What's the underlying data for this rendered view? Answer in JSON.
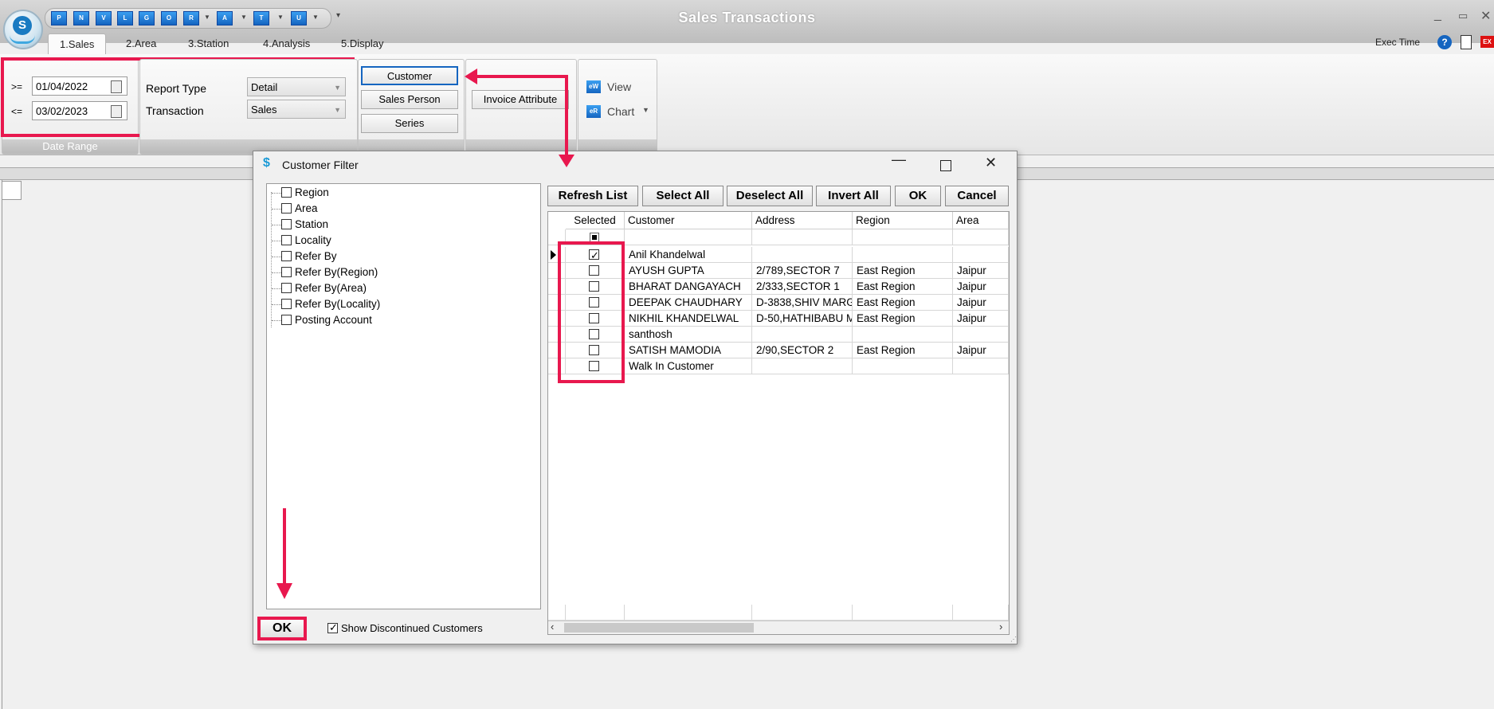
{
  "app": {
    "title": "Sales Transactions",
    "exec_time_label": "Exec Time",
    "logo_letter": "S"
  },
  "quick_access": [
    {
      "label": "P",
      "icon": "p-icon"
    },
    {
      "label": "N",
      "icon": "n-icon"
    },
    {
      "label": "V",
      "icon": "v-icon"
    },
    {
      "label": "L",
      "icon": "l-icon"
    },
    {
      "label": "G",
      "icon": "g-icon"
    },
    {
      "label": "O",
      "icon": "o-icon"
    },
    {
      "label": "R",
      "icon": "r-icon"
    },
    {
      "label": "A",
      "icon": "a-icon"
    },
    {
      "label": "T",
      "icon": "t-icon"
    },
    {
      "label": "U",
      "icon": "u-icon"
    }
  ],
  "tabs": [
    "1.Sales",
    "2.Area",
    "3.Station",
    "4.Analysis",
    "5.Display"
  ],
  "ribbon": {
    "date_range": {
      "from_op": ">=",
      "from": "01/04/2022",
      "to_op": "<=",
      "to": "03/02/2023",
      "group_label": "Date Range"
    },
    "report_type_label": "Report Type",
    "report_type_value": "Detail",
    "transaction_label": "Transaction",
    "transaction_value": "Sales",
    "filter_buttons": [
      "Customer",
      "Sales Person",
      "Series"
    ],
    "invoice_attribute": "Invoice Attribute",
    "view_label": "View",
    "chart_label": "Chart"
  },
  "dialog": {
    "title": "Customer Filter",
    "tree_items": [
      "Region",
      "Area",
      "Station",
      "Locality",
      "Refer By",
      "Refer By(Region)",
      "Refer By(Area)",
      "Refer By(Locality)",
      "Posting Account"
    ],
    "buttons": [
      "Refresh List",
      "Select All",
      "Deselect All",
      "Invert All",
      "OK",
      "Cancel"
    ],
    "ok_label": "OK",
    "show_discontinued_label": "Show Discontinued Customers",
    "show_discontinued_checked": true,
    "grid": {
      "columns": [
        "Selected",
        "Customer",
        "Address",
        "Region",
        "Area"
      ],
      "rows": [
        {
          "selected": true,
          "customer": "Anil Khandelwal",
          "address": "",
          "region": "",
          "area": ""
        },
        {
          "selected": false,
          "customer": "AYUSH GUPTA",
          "address": "2/789,SECTOR 7",
          "region": "East Region",
          "area": "Jaipur"
        },
        {
          "selected": false,
          "customer": "BHARAT DANGAYACH",
          "address": "2/333,SECTOR 1",
          "region": "East Region",
          "area": "Jaipur"
        },
        {
          "selected": false,
          "customer": "DEEPAK CHAUDHARY",
          "address": "D-3838,SHIV MARG",
          "region": "East Region",
          "area": "Jaipur"
        },
        {
          "selected": false,
          "customer": "NIKHIL KHANDELWAL",
          "address": "D-50,HATHIBABU M",
          "region": "East Region",
          "area": "Jaipur"
        },
        {
          "selected": false,
          "customer": "santhosh",
          "address": "",
          "region": "",
          "area": ""
        },
        {
          "selected": false,
          "customer": "SATISH MAMODIA",
          "address": "2/90,SECTOR 2",
          "region": "East Region",
          "area": "Jaipur"
        },
        {
          "selected": false,
          "customer": "Walk In Customer",
          "address": "",
          "region": "",
          "area": ""
        }
      ]
    }
  },
  "colors": {
    "highlight": "#e8184e",
    "accent_blue": "#1565c0"
  }
}
